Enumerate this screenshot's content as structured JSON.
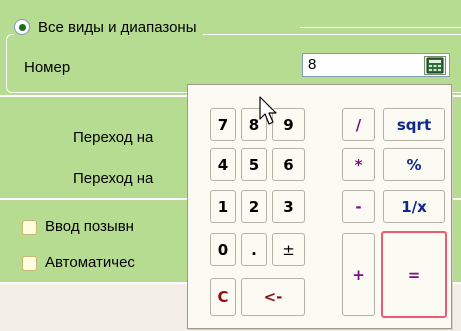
{
  "form": {
    "radio_label": "Все виды и диапазоны",
    "number_label": "Номер",
    "number_value": "8",
    "transition_label_1": "Переход на",
    "transition_label_2": "Переход на",
    "checkbox_label_1": "Ввод позывн",
    "checkbox_label_2": "Автоматичес"
  },
  "calculator": {
    "keys": [
      "7",
      "8",
      "9",
      "/",
      "sqrt",
      "4",
      "5",
      "6",
      "*",
      "%",
      "1",
      "2",
      "3",
      "-",
      "1/x",
      "0",
      ".",
      "±",
      "+",
      "=",
      "C",
      "<-"
    ]
  },
  "colors": {
    "panel_green": "#b6dc92",
    "key_purple": "#7b0f86",
    "key_blue": "#0d2a8c",
    "key_red": "#8c1111",
    "highlight_border": "#ef5a70"
  }
}
